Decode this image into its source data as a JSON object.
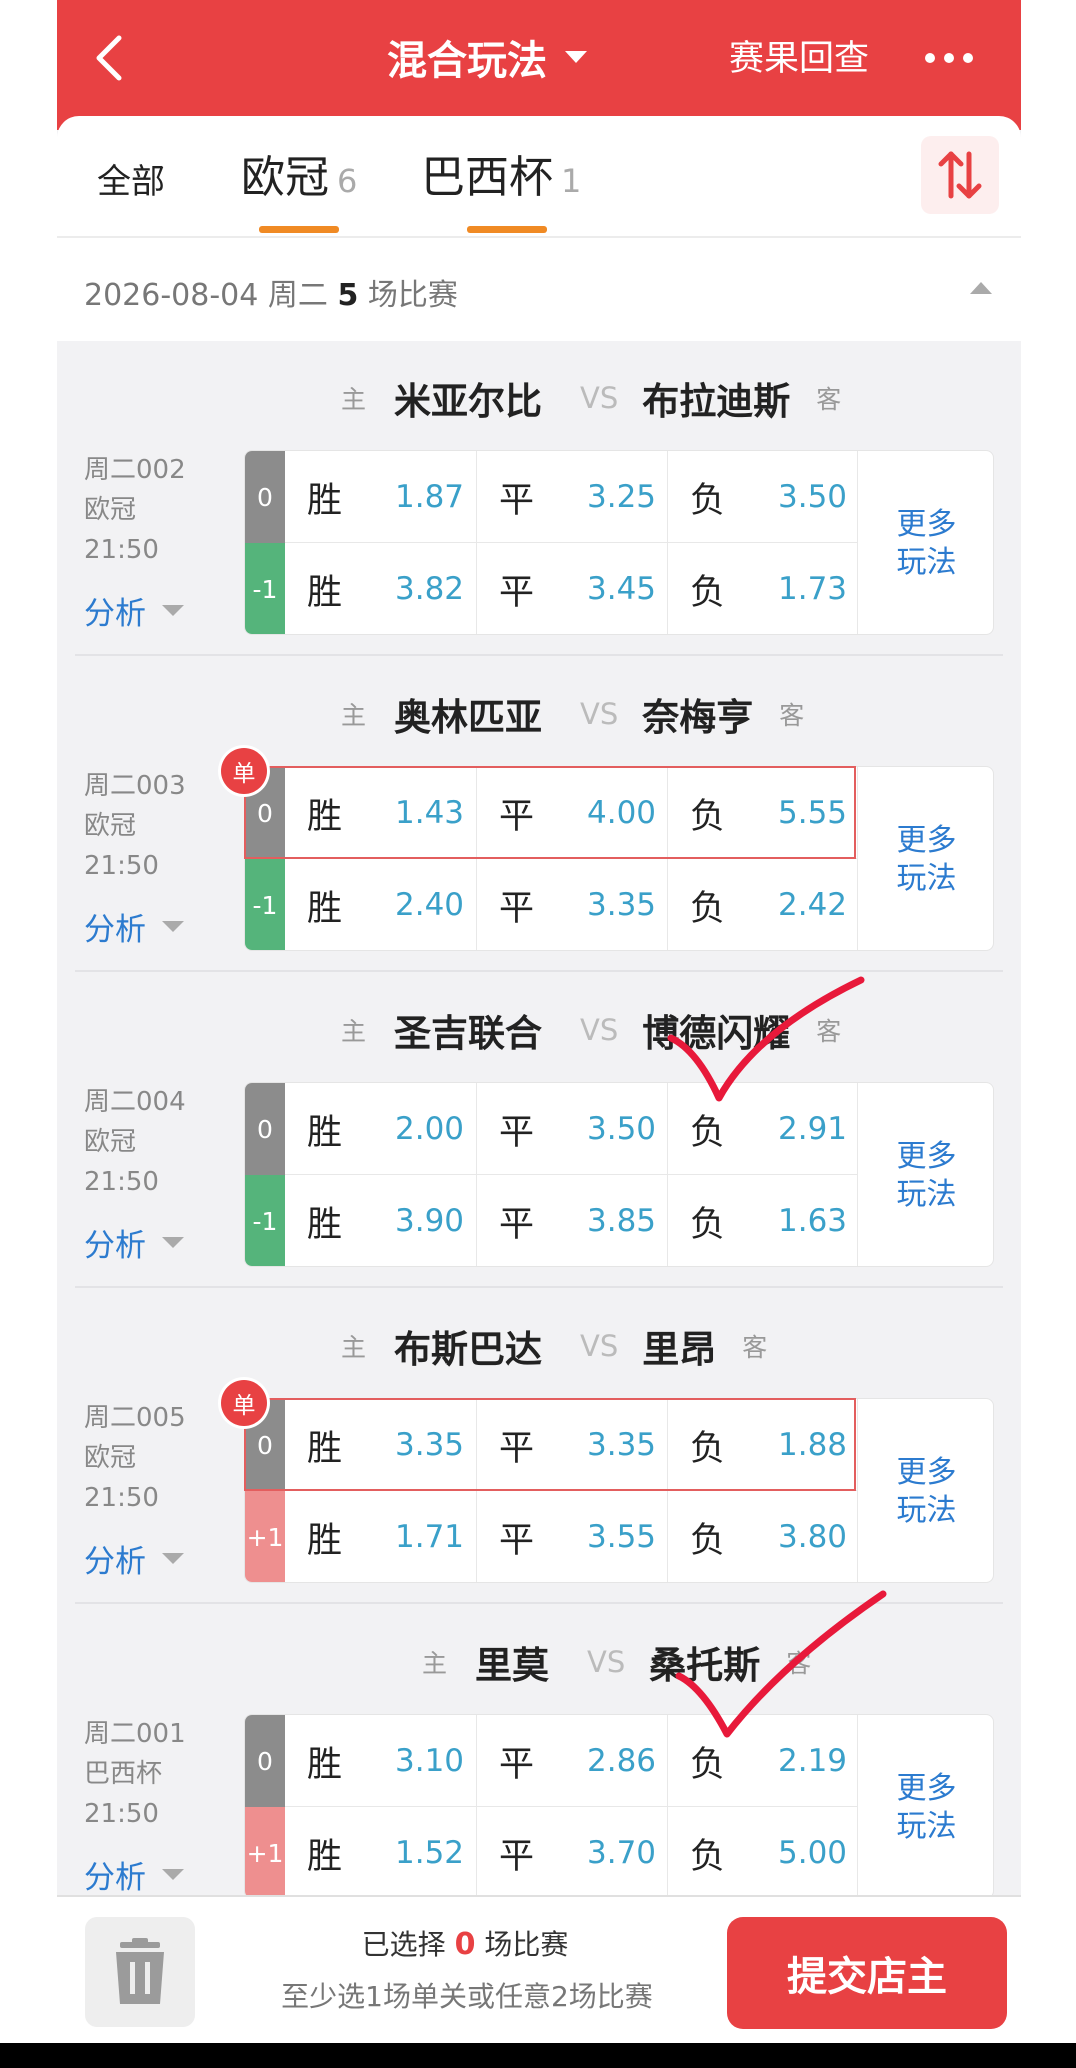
{
  "header": {
    "title": "混合玩法",
    "results_link": "赛果回查"
  },
  "filters": {
    "all_label": "全部",
    "tabs": [
      {
        "name": "欧冠",
        "count": "6"
      },
      {
        "name": "巴西杯",
        "count": "1"
      }
    ]
  },
  "date_group": {
    "date": "2026-08-04 周二",
    "count": "5",
    "suffix": "场比赛"
  },
  "labels": {
    "home": "主",
    "away": "客",
    "vs": "VS",
    "win": "胜",
    "draw": "平",
    "lose": "负",
    "analysis": "分析",
    "more_line1": "更多",
    "more_line2": "玩法",
    "single": "单"
  },
  "matches": [
    {
      "code": "周二002",
      "league": "欧冠",
      "time": "21:50",
      "home": "米亚尔比",
      "away": "布拉迪斯",
      "single": false,
      "rows": [
        {
          "handicap": "0",
          "win": "1.87",
          "draw": "3.25",
          "lose": "3.50"
        },
        {
          "handicap": "-1",
          "win": "3.82",
          "draw": "3.45",
          "lose": "1.73"
        }
      ]
    },
    {
      "code": "周二003",
      "league": "欧冠",
      "time": "21:50",
      "home": "奥林匹亚",
      "away": "奈梅亨",
      "single": true,
      "rows": [
        {
          "handicap": "0",
          "win": "1.43",
          "draw": "4.00",
          "lose": "5.55"
        },
        {
          "handicap": "-1",
          "win": "2.40",
          "draw": "3.35",
          "lose": "2.42"
        }
      ]
    },
    {
      "code": "周二004",
      "league": "欧冠",
      "time": "21:50",
      "home": "圣吉联合",
      "away": "博德闪耀",
      "single": false,
      "rows": [
        {
          "handicap": "0",
          "win": "2.00",
          "draw": "3.50",
          "lose": "2.91"
        },
        {
          "handicap": "-1",
          "win": "3.90",
          "draw": "3.85",
          "lose": "1.63"
        }
      ]
    },
    {
      "code": "周二005",
      "league": "欧冠",
      "time": "21:50",
      "home": "布斯巴达",
      "away": "里昂",
      "single": true,
      "rows": [
        {
          "handicap": "0",
          "win": "3.35",
          "draw": "3.35",
          "lose": "1.88"
        },
        {
          "handicap": "+1",
          "win": "1.71",
          "draw": "3.55",
          "lose": "3.80"
        }
      ]
    },
    {
      "code": "周二001",
      "league": "巴西杯",
      "time": "21:50",
      "home": "里莫",
      "away": "桑托斯",
      "single": false,
      "rows": [
        {
          "handicap": "0",
          "win": "3.10",
          "draw": "2.86",
          "lose": "2.19"
        },
        {
          "handicap": "+1",
          "win": "1.52",
          "draw": "3.70",
          "lose": "5.00"
        }
      ]
    }
  ],
  "footer": {
    "selected_prefix": "已选择",
    "selected_count": "0",
    "selected_suffix": "场比赛",
    "hint": "至少选1场单关或任意2场比赛",
    "submit": "提交店主"
  },
  "colors": {
    "brand_red": "#e84143",
    "odds_blue": "#3aa0c9",
    "link_blue": "#2c7bcf",
    "tab_underline": "#f08a24",
    "handicap_zero": "#8c8c8c",
    "handicap_minus": "#55b47b",
    "handicap_plus": "#ee8f8f"
  },
  "icons": [
    "back-arrow-icon",
    "dropdown-caret-icon",
    "more-dots-icon",
    "sort-icon",
    "collapse-caret-icon",
    "trash-icon",
    "checkmark-icon"
  ]
}
